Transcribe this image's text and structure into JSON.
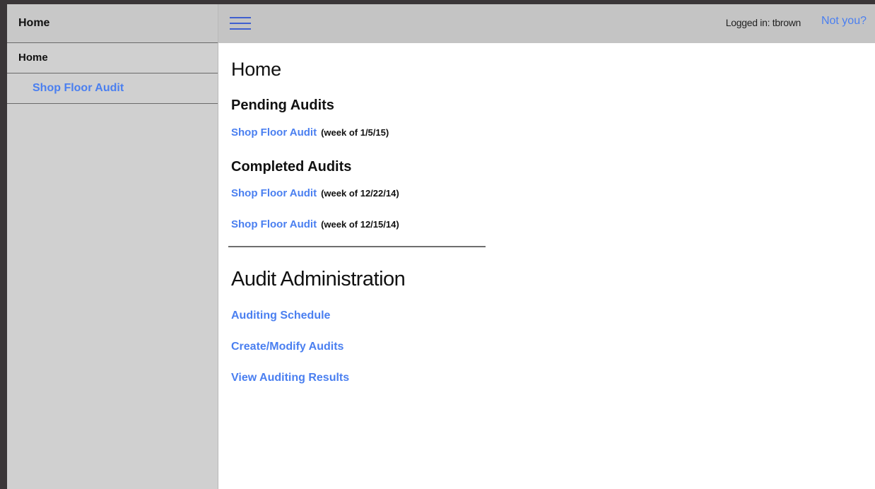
{
  "sidebar": {
    "header": "Home",
    "items": [
      {
        "label": "Home"
      },
      {
        "label": "Shop Floor Audit"
      }
    ]
  },
  "topbar": {
    "logged_in": "Logged in: tbrown",
    "not_you": "Not you?"
  },
  "main": {
    "title": "Home",
    "pending_title": "Pending Audits",
    "pending": [
      {
        "link": "Shop Floor Audit",
        "week": "(week of 1/5/15)"
      }
    ],
    "completed_title": "Completed Audits",
    "completed": [
      {
        "link": "Shop Floor Audit",
        "week": "(week of 12/22/14)"
      },
      {
        "link": "Shop Floor Audit",
        "week": "(week of 12/15/14)"
      }
    ],
    "admin_title": "Audit Administration",
    "admin_links": [
      {
        "label": "Auditing Schedule"
      },
      {
        "label": "Create/Modify Audits"
      },
      {
        "label": "View Auditing Results"
      }
    ]
  },
  "colors": {
    "link": "#4a7ff0",
    "sidebar_bg": "#d0d0d0",
    "topbar_bg": "#c4c4c4"
  }
}
